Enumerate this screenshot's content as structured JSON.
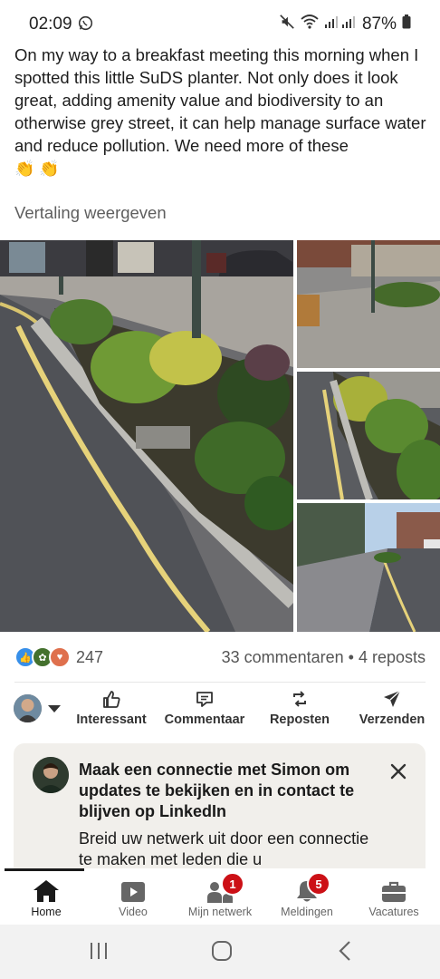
{
  "status_bar": {
    "time": "02:09",
    "battery": "87%"
  },
  "post": {
    "text": "On my way to a breakfast meeting this morning when I spotted this little SuDS planter. Not only does it look great, adding amenity value and biodiversity to an otherwise grey street, it can help manage surface water and reduce pollution. We need more of these",
    "emoji": "👏 👏",
    "translate_label": "Vertaling weergeven"
  },
  "engagement": {
    "reaction_count": "247",
    "stats": "33 commentaren • 4 reposts"
  },
  "actions": [
    {
      "label": "Interessant",
      "icon": "like-icon"
    },
    {
      "label": "Commentaar",
      "icon": "comment-icon"
    },
    {
      "label": "Reposten",
      "icon": "repost-icon"
    },
    {
      "label": "Verzenden",
      "icon": "send-icon"
    }
  ],
  "connect_card": {
    "title": "Maak een connectie met Simon om updates te bekijken en in contact te blijven op LinkedIn",
    "description": "Breid uw netwerk uit door een connectie te maken met leden die u"
  },
  "bottom_nav": [
    {
      "label": "Home",
      "icon": "home-icon",
      "active": true
    },
    {
      "label": "Video",
      "icon": "video-icon"
    },
    {
      "label": "Mijn netwerk",
      "icon": "network-icon",
      "badge": "1"
    },
    {
      "label": "Meldingen",
      "icon": "bell-icon",
      "badge": "5"
    },
    {
      "label": "Vacatures",
      "icon": "briefcase-icon"
    }
  ],
  "colors": {
    "badge": "#cc1016",
    "linkedin_blue": "#0a66c2",
    "card_bg": "#f1efeb"
  }
}
